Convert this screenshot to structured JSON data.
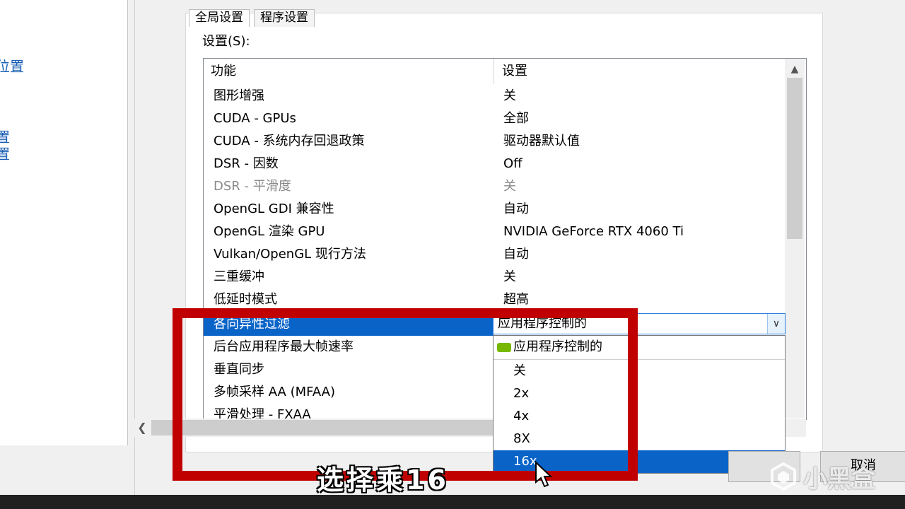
{
  "left_nav": {
    "items": [
      "位置",
      "置",
      "置"
    ]
  },
  "tabs": [
    {
      "label": "全局设置"
    },
    {
      "label": "程序设置"
    }
  ],
  "settings_label": "设置(S):",
  "list": {
    "headers": {
      "feature": "功能",
      "setting": "设置"
    },
    "rows": [
      {
        "feature": "图形增强",
        "value": "关"
      },
      {
        "feature": "CUDA - GPUs",
        "value": "全部"
      },
      {
        "feature": "CUDA - 系统内存回退政策",
        "value": "驱动器默认值"
      },
      {
        "feature": "DSR - 因数",
        "value": "Off"
      },
      {
        "feature": "DSR - 平滑度",
        "value": "关"
      },
      {
        "feature": "OpenGL GDI 兼容性",
        "value": "自动"
      },
      {
        "feature": "OpenGL 渲染 GPU",
        "value": "NVIDIA GeForce RTX 4060 Ti"
      },
      {
        "feature": "Vulkan/OpenGL 现行方法",
        "value": "自动"
      },
      {
        "feature": "三重缓冲",
        "value": "关"
      },
      {
        "feature": "低延时模式",
        "value": "超高"
      },
      {
        "feature": "各向异性过滤",
        "value": ""
      },
      {
        "feature": "后台应用程序最大帧速率",
        "value": ""
      },
      {
        "feature": "垂直同步",
        "value": ""
      },
      {
        "feature": "多帧采样 AA (MFAA)",
        "value": ""
      },
      {
        "feature": "平滑处理 - FXAA",
        "value": ""
      }
    ]
  },
  "combo": {
    "value": "应用程序控制的"
  },
  "dropdown": {
    "options": [
      "应用程序控制的",
      "关",
      "2x",
      "4x",
      "8X",
      "16x"
    ],
    "highlighted": "16x"
  },
  "buttons": {
    "cancel": "取消"
  },
  "caption": "选择乘16",
  "watermark": "小黑盒",
  "colors": {
    "selection": "#0a64c8",
    "annotation": "#c00000",
    "nvidia": "#76b900"
  }
}
